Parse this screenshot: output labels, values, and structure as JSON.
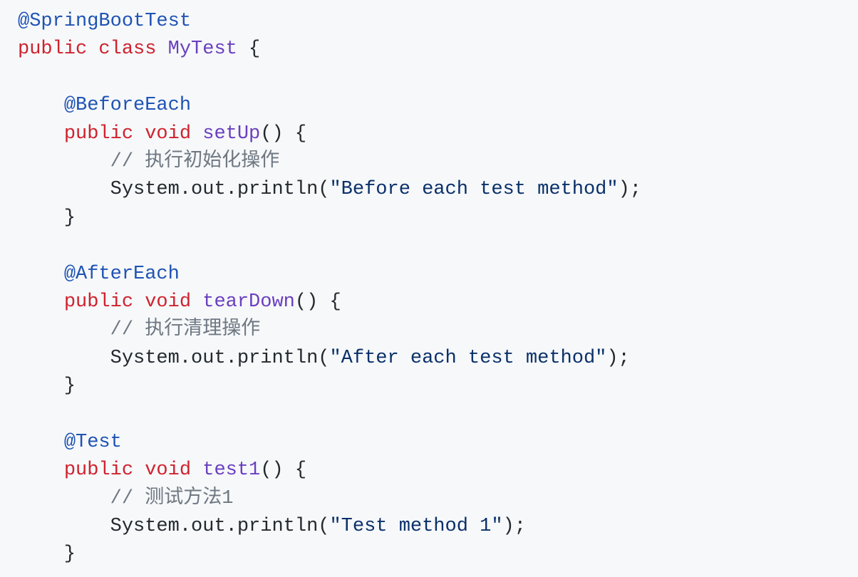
{
  "code": {
    "lines": [
      [
        {
          "t": "@SpringBootTest",
          "c": "annotation"
        }
      ],
      [
        {
          "t": "public",
          "c": "keyword"
        },
        {
          "t": " ",
          "c": "plain"
        },
        {
          "t": "class",
          "c": "keyword"
        },
        {
          "t": " ",
          "c": "plain"
        },
        {
          "t": "MyTest",
          "c": "name"
        },
        {
          "t": " {",
          "c": "plain"
        }
      ],
      [],
      [
        {
          "t": "    ",
          "c": "plain"
        },
        {
          "t": "@BeforeEach",
          "c": "annotation"
        }
      ],
      [
        {
          "t": "    ",
          "c": "plain"
        },
        {
          "t": "public",
          "c": "keyword"
        },
        {
          "t": " ",
          "c": "plain"
        },
        {
          "t": "void",
          "c": "keyword"
        },
        {
          "t": " ",
          "c": "plain"
        },
        {
          "t": "setUp",
          "c": "name"
        },
        {
          "t": "() {",
          "c": "plain"
        }
      ],
      [
        {
          "t": "        ",
          "c": "plain"
        },
        {
          "t": "// 执行初始化操作",
          "c": "comment"
        }
      ],
      [
        {
          "t": "        System.out.println(",
          "c": "plain"
        },
        {
          "t": "\"Before each test method\"",
          "c": "string"
        },
        {
          "t": ");",
          "c": "plain"
        }
      ],
      [
        {
          "t": "    }",
          "c": "plain"
        }
      ],
      [],
      [
        {
          "t": "    ",
          "c": "plain"
        },
        {
          "t": "@AfterEach",
          "c": "annotation"
        }
      ],
      [
        {
          "t": "    ",
          "c": "plain"
        },
        {
          "t": "public",
          "c": "keyword"
        },
        {
          "t": " ",
          "c": "plain"
        },
        {
          "t": "void",
          "c": "keyword"
        },
        {
          "t": " ",
          "c": "plain"
        },
        {
          "t": "tearDown",
          "c": "name"
        },
        {
          "t": "() {",
          "c": "plain"
        }
      ],
      [
        {
          "t": "        ",
          "c": "plain"
        },
        {
          "t": "// 执行清理操作",
          "c": "comment"
        }
      ],
      [
        {
          "t": "        System.out.println(",
          "c": "plain"
        },
        {
          "t": "\"After each test method\"",
          "c": "string"
        },
        {
          "t": ");",
          "c": "plain"
        }
      ],
      [
        {
          "t": "    }",
          "c": "plain"
        }
      ],
      [],
      [
        {
          "t": "    ",
          "c": "plain"
        },
        {
          "t": "@Test",
          "c": "annotation"
        }
      ],
      [
        {
          "t": "    ",
          "c": "plain"
        },
        {
          "t": "public",
          "c": "keyword"
        },
        {
          "t": " ",
          "c": "plain"
        },
        {
          "t": "void",
          "c": "keyword"
        },
        {
          "t": " ",
          "c": "plain"
        },
        {
          "t": "test1",
          "c": "name"
        },
        {
          "t": "() {",
          "c": "plain"
        }
      ],
      [
        {
          "t": "        ",
          "c": "plain"
        },
        {
          "t": "// 测试方法1",
          "c": "comment"
        }
      ],
      [
        {
          "t": "        System.out.println(",
          "c": "plain"
        },
        {
          "t": "\"Test method 1\"",
          "c": "string"
        },
        {
          "t": ");",
          "c": "plain"
        }
      ],
      [
        {
          "t": "    }",
          "c": "plain"
        }
      ]
    ]
  },
  "colors": {
    "background": "#f6f8fa",
    "annotation": "#1f53b4",
    "keyword": "#cf222e",
    "name": "#6a3fbf",
    "string": "#0a3069",
    "comment": "#6e7781",
    "plain": "#24292e"
  }
}
